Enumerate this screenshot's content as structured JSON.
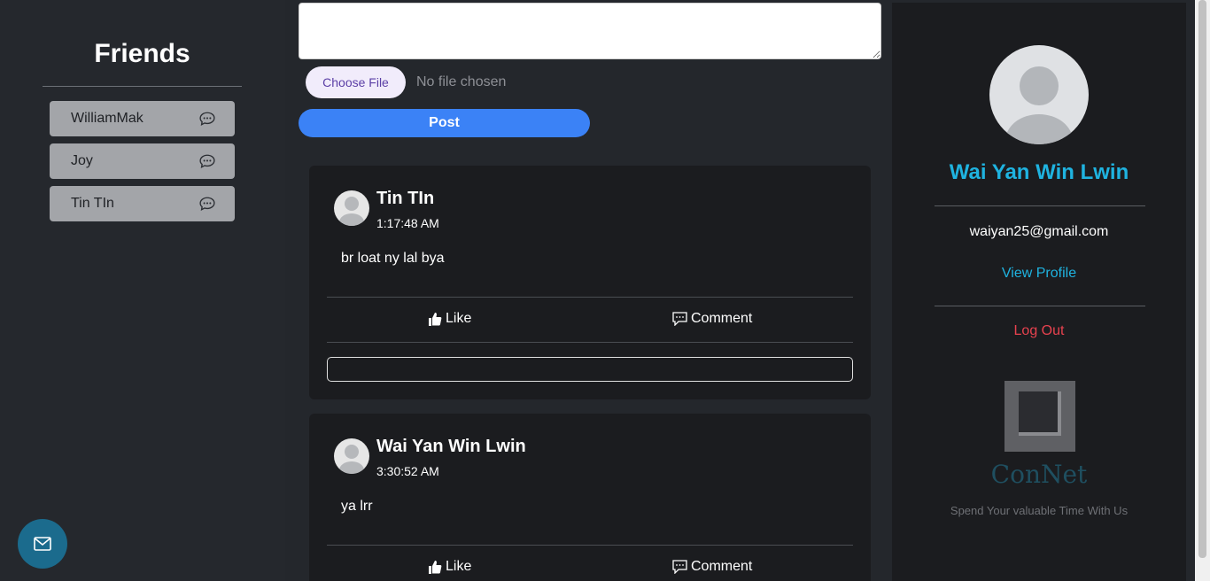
{
  "friends": {
    "title": "Friends",
    "items": [
      {
        "name": "WilliamMak"
      },
      {
        "name": "Joy"
      },
      {
        "name": "Tin TIn"
      }
    ]
  },
  "composer": {
    "choose_file_label": "Choose File",
    "no_file_text": "No file chosen",
    "post_label": "Post"
  },
  "posts": [
    {
      "author": "Tin TIn",
      "time": "1:17:48 AM",
      "body": "br loat ny lal bya",
      "like_label": "Like",
      "comment_label": "Comment"
    },
    {
      "author": "Wai Yan Win Lwin",
      "time": "3:30:52 AM",
      "body": "ya lrr",
      "like_label": "Like",
      "comment_label": "Comment"
    }
  ],
  "profile": {
    "name": "Wai Yan Win Lwin",
    "email": "waiyan25@gmail.com",
    "view_profile_label": "View Profile",
    "logout_label": "Log Out"
  },
  "brand": {
    "name": "ConNet",
    "tagline": "Spend Your valuable Time With Us"
  },
  "colors": {
    "accent": "#1fb3e0",
    "post_button": "#3b82f6",
    "logout": "#e8424f"
  }
}
